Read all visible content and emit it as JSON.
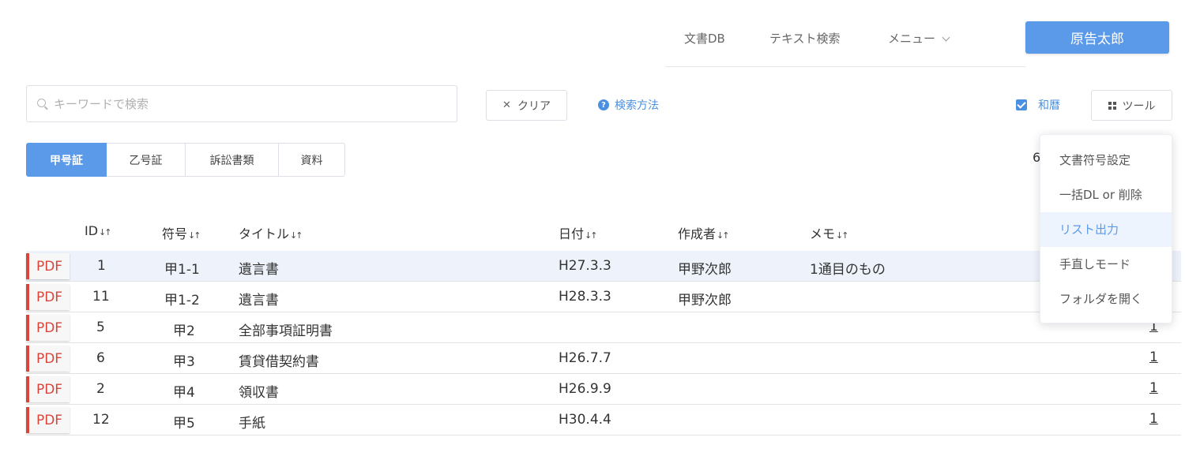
{
  "header": {
    "nav": [
      {
        "label": "文書DB"
      },
      {
        "label": "テキスト検索"
      },
      {
        "label": "メニュー"
      }
    ],
    "user_name": "原告太郎"
  },
  "toolbar": {
    "search_placeholder": "キーワードで検索",
    "search_value": "",
    "clear_label": "クリア",
    "help_label": "検索方法",
    "help_icon_glyph": "?",
    "wareki_label": "和暦",
    "wareki_checked": true,
    "tool_label": "ツール"
  },
  "tabs": [
    {
      "label": "甲号証",
      "active": true
    },
    {
      "label": "乙号証",
      "active": false
    },
    {
      "label": "訴訟書類",
      "active": false
    },
    {
      "label": "資料",
      "active": false
    }
  ],
  "partial_text": "6",
  "table": {
    "headers": {
      "id": "ID",
      "code": "符号",
      "title": "タイトル",
      "date": "日付",
      "author": "作成者",
      "memo": "メモ"
    },
    "sort_glyph": "↓↑",
    "rows": [
      {
        "pdf": "PDF",
        "id": "1",
        "code": "甲1-1",
        "title": "遺言書",
        "date": "H27.3.3",
        "author": "甲野次郎",
        "memo": "1通目のもの",
        "count": ""
      },
      {
        "pdf": "PDF",
        "id": "11",
        "code": "甲1-2",
        "title": "遺言書",
        "date": "H28.3.3",
        "author": "甲野次郎",
        "memo": "",
        "count": ""
      },
      {
        "pdf": "PDF",
        "id": "5",
        "code": "甲2",
        "title": "全部事項証明書",
        "date": "",
        "author": "",
        "memo": "",
        "count": "1"
      },
      {
        "pdf": "PDF",
        "id": "6",
        "code": "甲3",
        "title": "賃貸借契約書",
        "date": "H26.7.7",
        "author": "",
        "memo": "",
        "count": "1"
      },
      {
        "pdf": "PDF",
        "id": "2",
        "code": "甲4",
        "title": "領収書",
        "date": "H26.9.9",
        "author": "",
        "memo": "",
        "count": "1"
      },
      {
        "pdf": "PDF",
        "id": "12",
        "code": "甲5",
        "title": "手紙",
        "date": "H30.4.4",
        "author": "",
        "memo": "",
        "count": "1"
      }
    ]
  },
  "tool_menu": {
    "items": [
      {
        "label": "文書符号設定"
      },
      {
        "label": "一括DL or 削除"
      },
      {
        "label": "リスト出力"
      },
      {
        "label": "手直しモード"
      },
      {
        "label": "フォルダを開く"
      }
    ]
  },
  "colors": {
    "accent": "#5a9ae8",
    "link": "#4a8fe0",
    "pdf_red": "#d8453a",
    "row_highlight": "#eef3fb"
  }
}
